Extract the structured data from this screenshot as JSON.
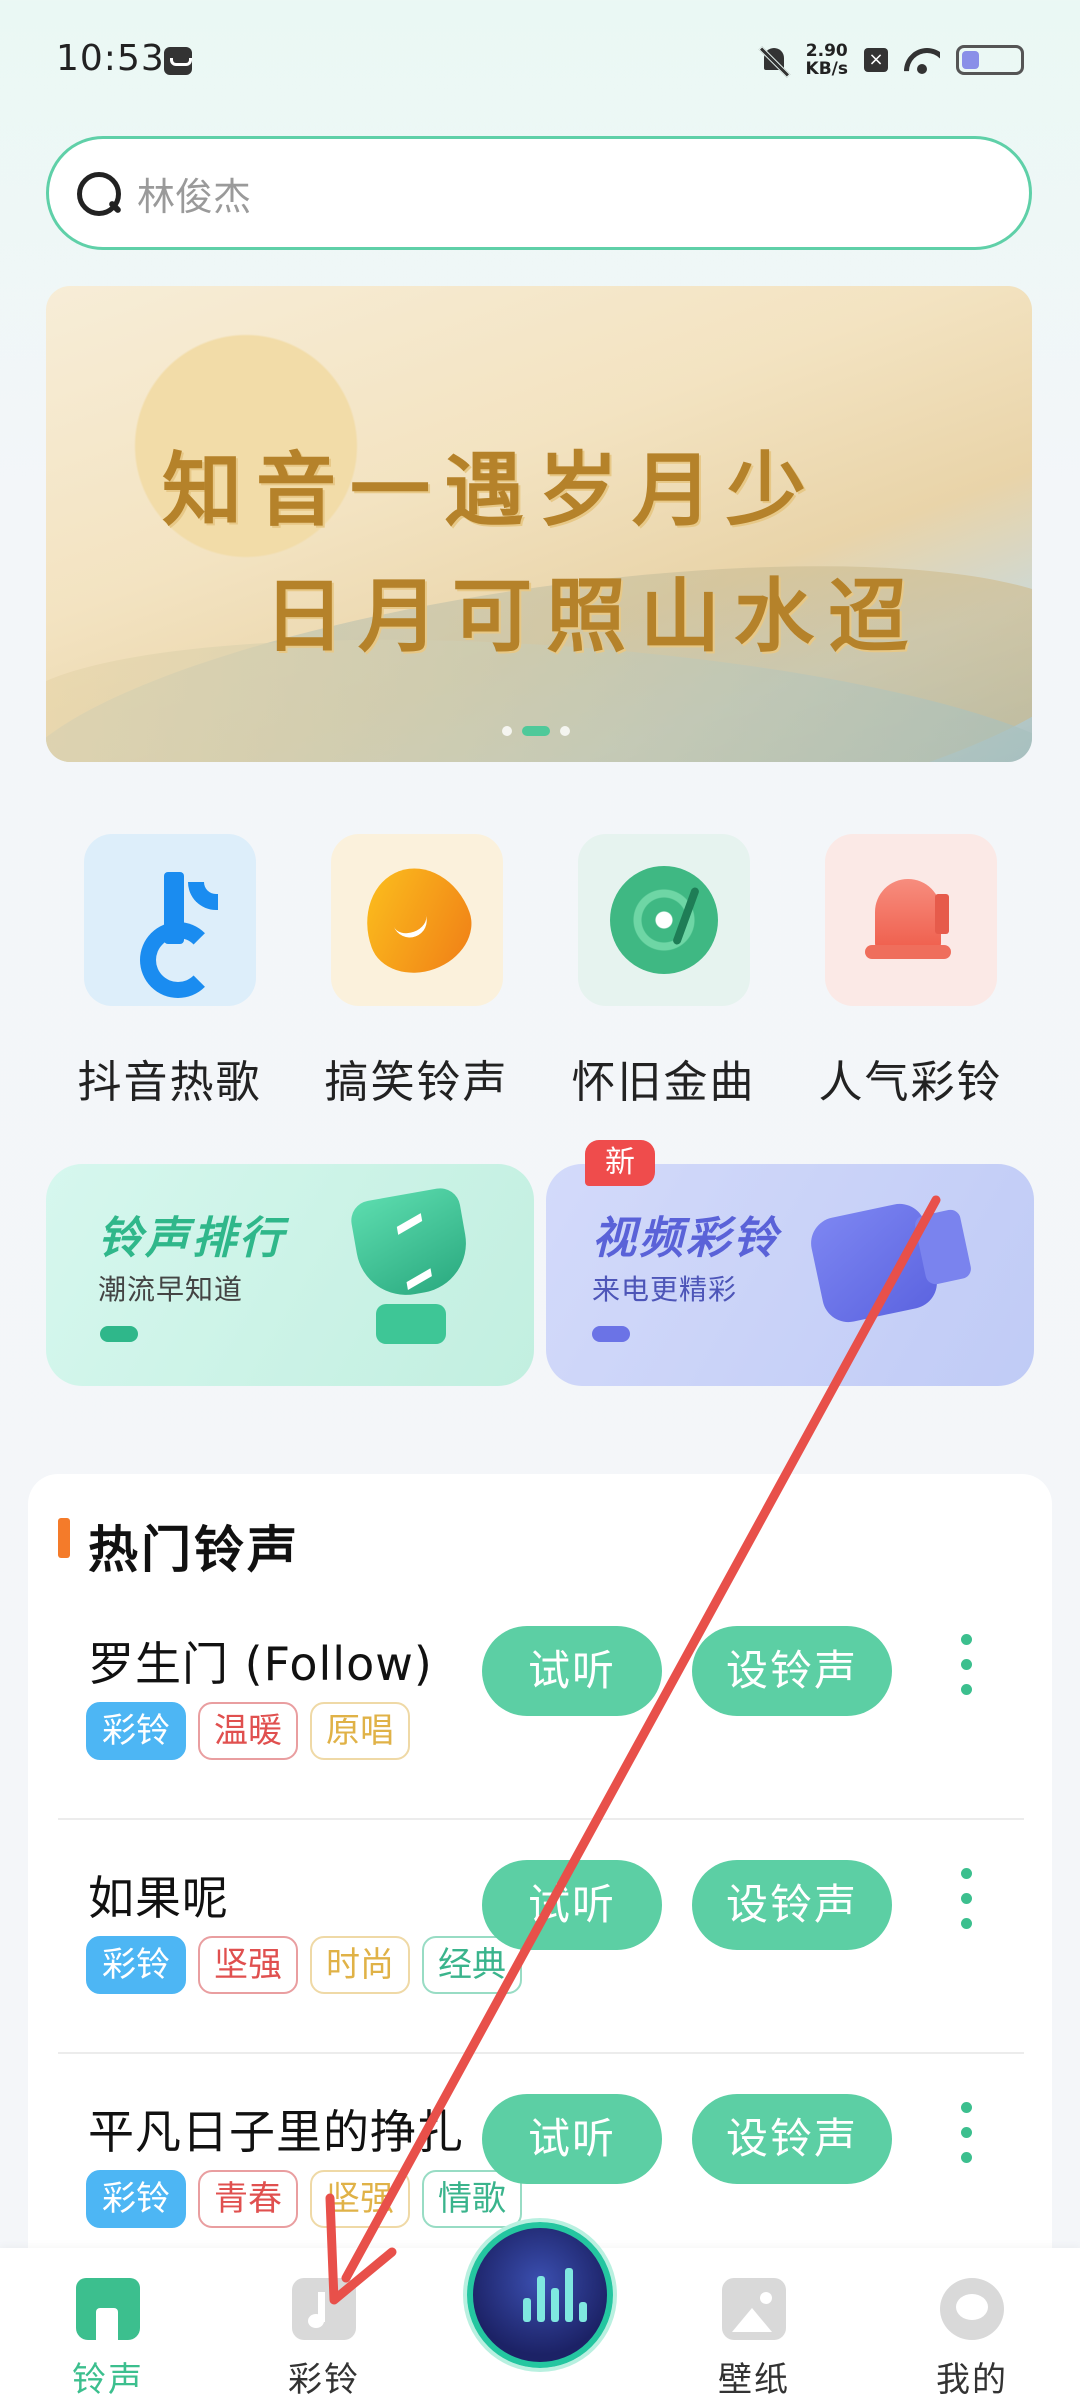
{
  "status_bar": {
    "time": "10:53",
    "net_speed_value": "2.90",
    "net_speed_unit": "KB/s",
    "battery_level": 0.3
  },
  "search": {
    "placeholder": "林俊杰"
  },
  "banner": {
    "line1": "知音一遇岁月少",
    "line2": "日月可照山水迢",
    "active_dot": 1,
    "dot_count": 3
  },
  "categories": [
    {
      "label": "抖音热歌",
      "icon": "douyin-note-icon"
    },
    {
      "label": "搞笑铃声",
      "icon": "funny-phone-icon"
    },
    {
      "label": "怀旧金曲",
      "icon": "vinyl-disc-icon"
    },
    {
      "label": "人气彩铃",
      "icon": "bell-icon"
    }
  ],
  "promos": {
    "rank": {
      "title": "铃声排行",
      "subtitle": "潮流早知道",
      "icon": "trophy-icon"
    },
    "video": {
      "title": "视频彩铃",
      "subtitle": "来电更精彩",
      "icon": "video-camera-icon",
      "badge": "新"
    }
  },
  "hot_section": {
    "title": "热门铃声",
    "listen_label": "试听",
    "set_label": "设铃声",
    "songs": [
      {
        "name": "罗生门 (Follow)",
        "tags": [
          "彩铃",
          "温暖",
          "原唱"
        ]
      },
      {
        "name": "如果呢",
        "tags": [
          "彩铃",
          "坚强",
          "时尚",
          "经典"
        ]
      },
      {
        "name": "平凡日子里的挣扎",
        "tags": [
          "彩铃",
          "青春",
          "坚强",
          "情歌"
        ]
      }
    ]
  },
  "bottom_nav": {
    "items": [
      {
        "label": "铃声",
        "icon": "home-icon",
        "active": true
      },
      {
        "label": "彩铃",
        "icon": "music-note-icon",
        "active": false
      },
      {
        "label": "",
        "icon": "music-visualizer-icon",
        "active": false
      },
      {
        "label": "壁纸",
        "icon": "image-icon",
        "active": false
      },
      {
        "label": "我的",
        "icon": "profile-icon",
        "active": false
      }
    ]
  },
  "colors": {
    "accent": "#5ccfa4",
    "accent_dark": "#3cbf8e",
    "tag_blue": "#4db6f4",
    "new_badge": "#ef4c4c",
    "arrow": "#e8504a"
  }
}
